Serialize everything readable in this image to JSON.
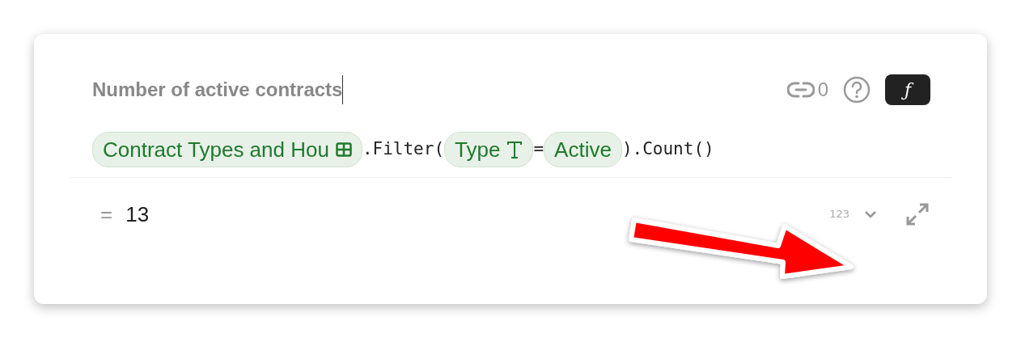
{
  "formula_name": {
    "value": "Number of active contracts"
  },
  "toolbar": {
    "link_count": "0",
    "formula_button": "ƒ"
  },
  "formula": [
    {
      "kind": "table-ref",
      "text": "Contract Types and Hou"
    },
    {
      "kind": "code",
      "text": ".Filter("
    },
    {
      "kind": "column-ref",
      "text": "Type"
    },
    {
      "kind": "code",
      "text": "="
    },
    {
      "kind": "value",
      "text": "Active"
    },
    {
      "kind": "code",
      "text": ").Count()"
    }
  ],
  "result": {
    "equals": "=",
    "value": "13",
    "format": "123"
  }
}
